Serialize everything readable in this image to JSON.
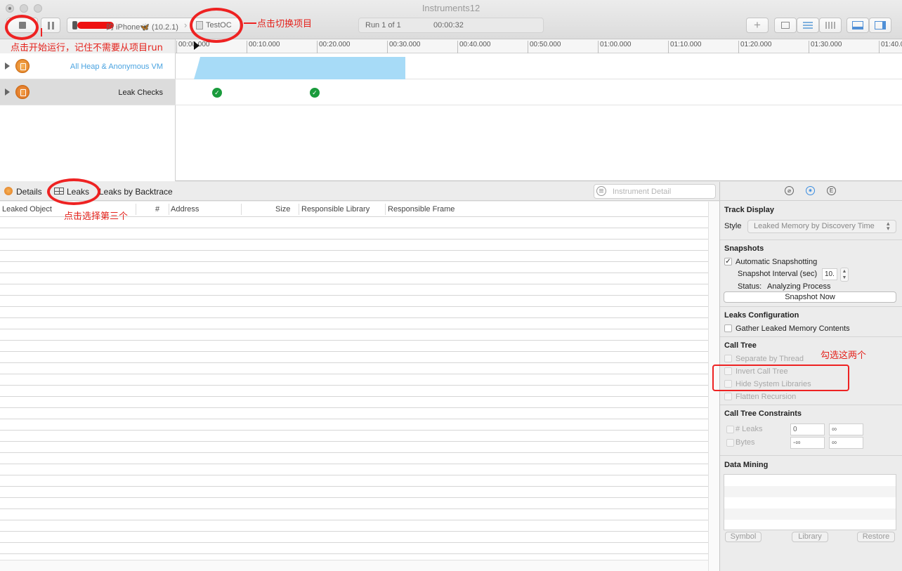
{
  "window": {
    "title": "Instruments12"
  },
  "toolbar": {
    "device": "的 iPhone🦋 (10.2.1)",
    "project": "TestOC",
    "run_label": "Run 1 of 1",
    "elapsed": "00:00:32"
  },
  "ruler": {
    "ticks": [
      "00:00.000",
      "00:10.000",
      "00:20.000",
      "00:30.000",
      "00:40.000",
      "00:50.000",
      "01:00.000",
      "01:10.000",
      "01:20.000",
      "01:30.000",
      "01:40.0"
    ]
  },
  "tracks": [
    {
      "name": "All Heap & Anonymous VM",
      "color": "#4aa3e0"
    },
    {
      "name": "Leak Checks"
    }
  ],
  "detail": {
    "crumbs": [
      "Details",
      "Leaks",
      "Leaks by Backtrace"
    ],
    "search_placeholder": "Instrument Detail"
  },
  "table": {
    "columns": [
      "Leaked Object",
      "#",
      "Address",
      "Size",
      "Responsible Library",
      "Responsible Frame"
    ]
  },
  "inspector": {
    "track_display": {
      "title": "Track Display",
      "style_label": "Style",
      "style_value": "Leaked Memory by Discovery Time"
    },
    "snapshots": {
      "title": "Snapshots",
      "auto_label": "Automatic Snapshotting",
      "auto_checked": "✓",
      "interval_label": "Snapshot Interval (sec)",
      "interval_value": "10.",
      "status_label": "Status:",
      "status_value": "Analyzing Process",
      "button": "Snapshot Now"
    },
    "leaks_config": {
      "title": "Leaks Configuration",
      "gather_label": "Gather Leaked Memory Contents"
    },
    "call_tree": {
      "title": "Call Tree",
      "options": [
        "Separate by Thread",
        "Invert Call Tree",
        "Hide System Libraries",
        "Flatten Recursion"
      ]
    },
    "constraints": {
      "title": "Call Tree Constraints",
      "leaks_label": "# Leaks",
      "leaks_min": "0",
      "leaks_max": "∞",
      "bytes_label": "Bytes",
      "bytes_min": "-∞",
      "bytes_max": "∞"
    },
    "data_mining": {
      "title": "Data Mining",
      "buttons": [
        "Symbol",
        "Library",
        "Restore"
      ]
    }
  },
  "annotations": {
    "start_run": "点击开始运行，记住不需要从项目run",
    "switch_project": "点击切换项目",
    "select_third": "点击选择第三个",
    "check_two": "勾选这两个",
    "color": "#ee2222"
  }
}
